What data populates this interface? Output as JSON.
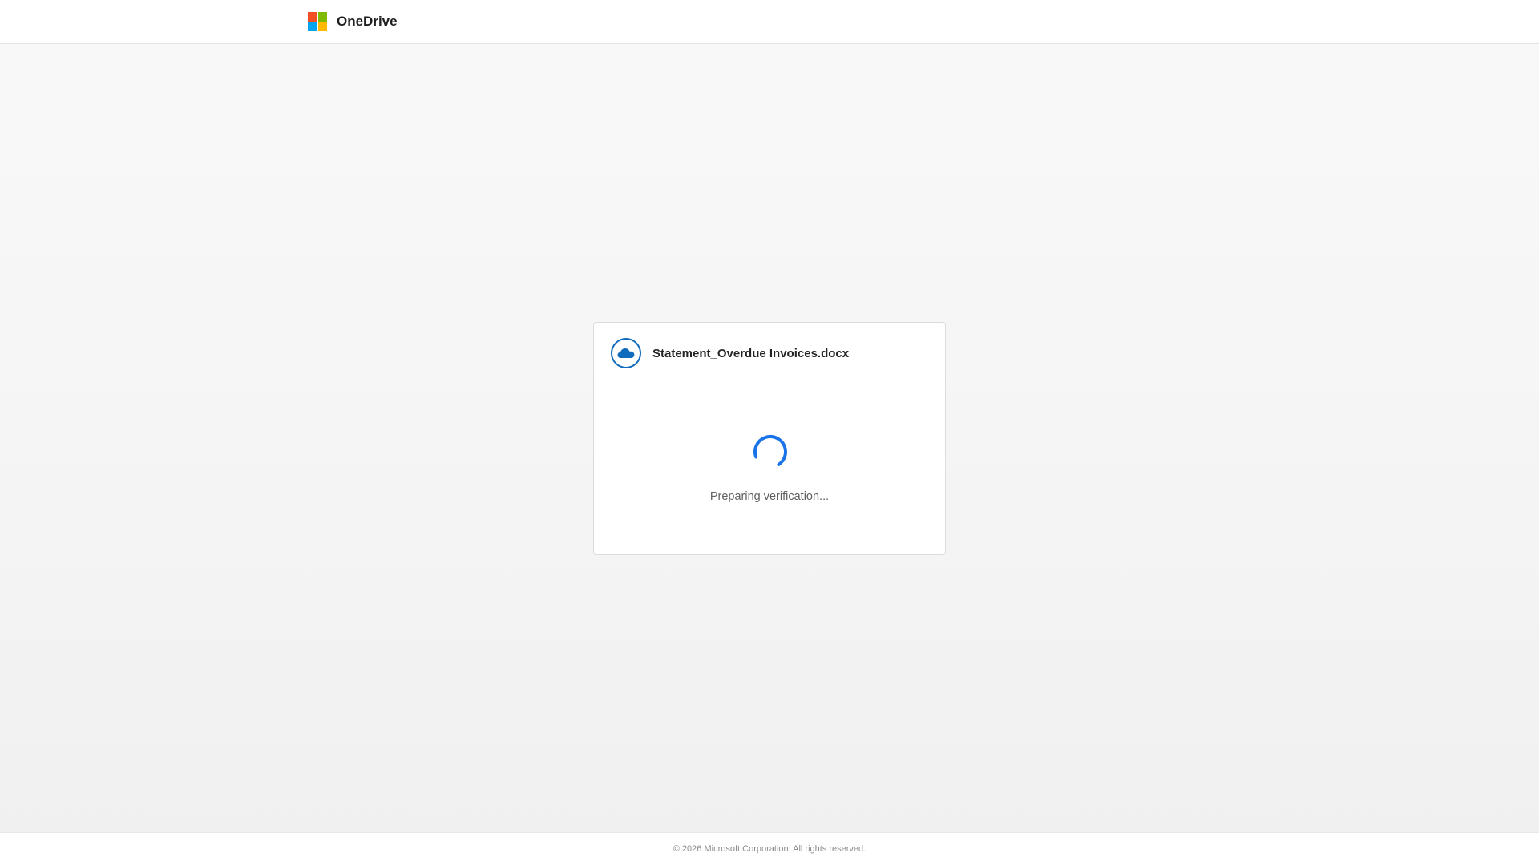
{
  "header": {
    "brand_name": "OneDrive",
    "logo_icon": "microsoft-logo-icon",
    "logo_colors": [
      "#f25022",
      "#7fba00",
      "#00a4ef",
      "#ffb900"
    ]
  },
  "card": {
    "file_icon": "onedrive-cloud-icon",
    "file_name": "Statement_Overdue Invoices.docx",
    "spinner_icon": "loading-spinner-icon",
    "status_text": "Preparing verification..."
  },
  "footer": {
    "copyright": "© 2026 Microsoft Corporation. All rights reserved."
  },
  "colors": {
    "accent": "#0f6cbd",
    "spinner": "#1a73e8"
  }
}
